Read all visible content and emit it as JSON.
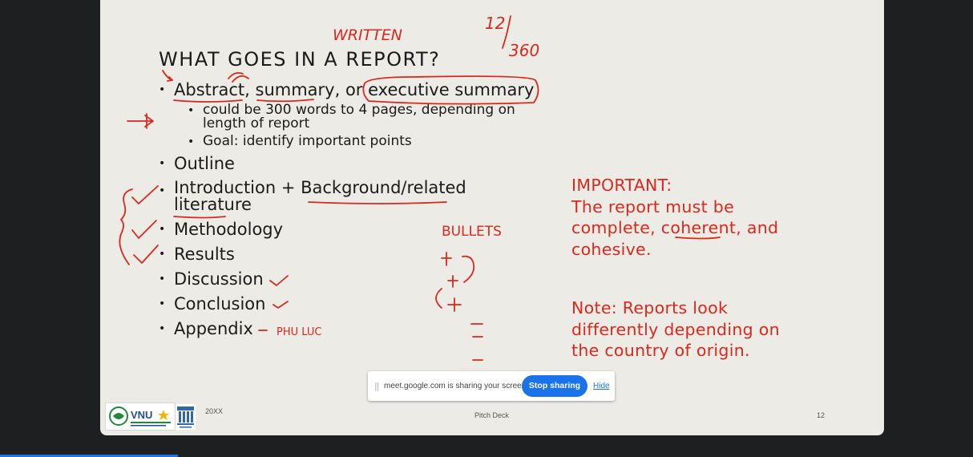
{
  "slide": {
    "title": "WHAT GOES IN A REPORT?",
    "bullets": {
      "abstract_line": "Abstract, summary, or executive summary",
      "sub1_line1": "could be 300 words to 4 pages, depending on",
      "sub1_line2": "length of report",
      "sub2": "Goal: identify important points",
      "outline": "Outline",
      "intro_line1": "Introduction + Background/related",
      "intro_line2": "literature",
      "methodology": "Methodology",
      "results": "Results",
      "discussion": "Discussion",
      "conclusion": "Conclusion",
      "appendix": "Appendix"
    },
    "important": {
      "line1": "IMPORTANT:",
      "line2": "The report must be",
      "line3": "complete, coherent, and",
      "line4": "cohesive."
    },
    "note": {
      "line1": "Note: Reports look",
      "line2": "differently depending on",
      "line3": "the country of origin."
    },
    "footer": {
      "year": "20XX",
      "deck_name": "Pitch Deck",
      "page_number": "12"
    },
    "logo_text": "VNU"
  },
  "annotations": {
    "written": "WRITTEN",
    "fraction_top": "12",
    "fraction_bottom": "360",
    "bullets": "BULLETS",
    "appendix_note": "PHU LUC"
  },
  "share_bar": {
    "grip": "||",
    "message": "meet.google.com is sharing your screen.",
    "stop_label": "Stop sharing",
    "hide_label": "Hide"
  },
  "colors": {
    "accent_red": "#d9291c",
    "share_blue": "#1a73e8",
    "slide_bg": "#ecebe6"
  }
}
